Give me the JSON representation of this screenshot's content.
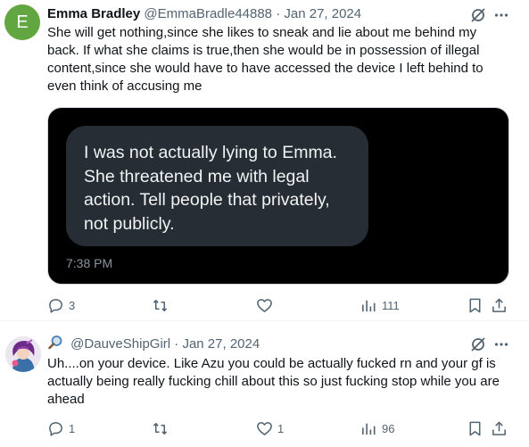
{
  "tweets": [
    {
      "avatar_letter": "E",
      "name": "Emma Bradley",
      "handle": "@EmmaBradle44888",
      "separator": "·",
      "date": "Jan 27, 2024",
      "text": "She will get nothing,since she likes to sneak and lie about me behind my back. If what she claims is true,then she would be in possession of illegal content,since she would have to have accessed the device I left behind to even think of accusing me",
      "media": {
        "bubble_text": "I was not actually lying to Emma. She threatened me with legal action. Tell people that privately, not publicly.",
        "time": "7:38 PM"
      },
      "actions": {
        "replies": "3",
        "reposts": "",
        "likes": "",
        "views": "111"
      }
    },
    {
      "name": "",
      "handle": "@DauveShipGirl",
      "separator": "·",
      "date": "Jan 27, 2024",
      "text": "Uh....on your device. Like Azu you could be actually fucked rn and your gf is actually being really fucking chill about this so just fucking stop while you are ahead",
      "actions": {
        "replies": "1",
        "reposts": "",
        "likes": "1",
        "views": "96"
      }
    }
  ],
  "icons": {
    "reply": "reply-icon",
    "repost": "repost-icon",
    "like": "like-icon",
    "views": "views-icon",
    "bookmark": "bookmark-icon",
    "share": "share-icon",
    "grok": "grok-icon",
    "more": "more-icon",
    "handle_emoji": "magnifying-glass-icon"
  },
  "colors": {
    "accent_avatar": "#61a641",
    "text_primary": "#0f1419",
    "text_secondary": "#536471",
    "media_bg": "#000000",
    "bubble_bg": "#262d34"
  }
}
